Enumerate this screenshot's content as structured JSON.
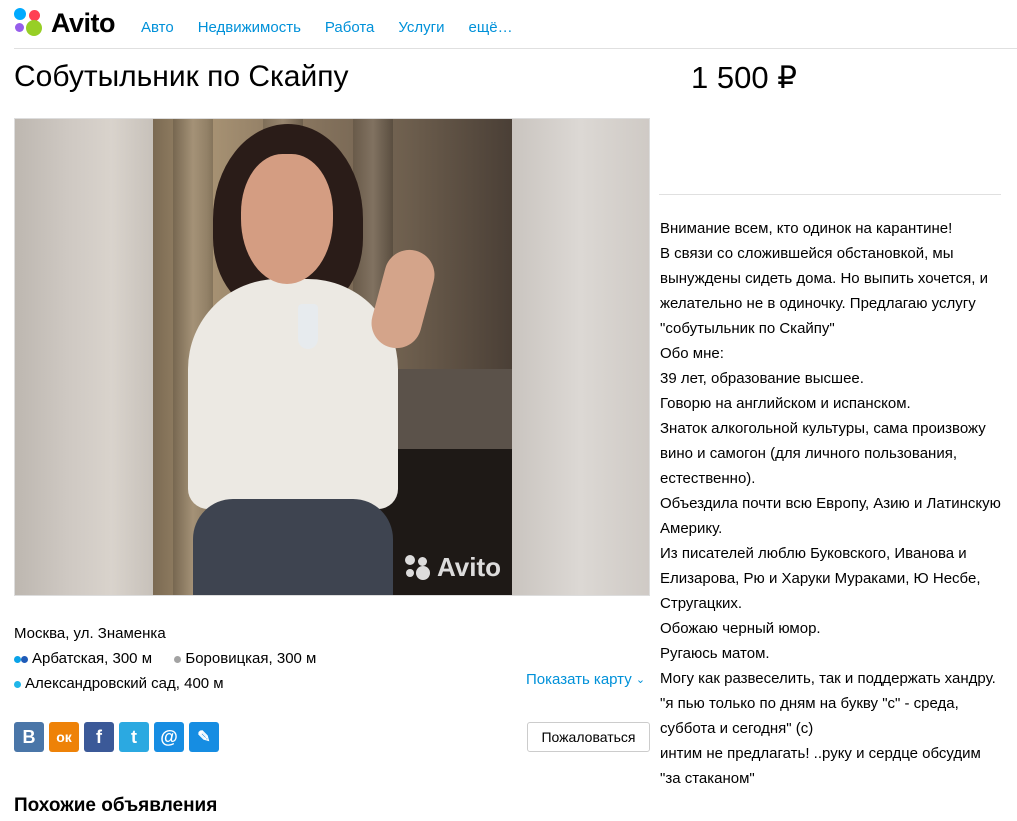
{
  "header": {
    "logo_text": "Avito",
    "nav": [
      "Авто",
      "Недвижимость",
      "Работа",
      "Услуги",
      "ещё…"
    ]
  },
  "listing": {
    "title": "Собутыльник по Скайпу",
    "price": "1 500 ₽",
    "watermark": "Avito"
  },
  "location": {
    "address": "Москва, ул. Знаменка",
    "metro": [
      {
        "name": "Арбатская, 300 м",
        "colors": [
          "#0aa3e8",
          "#1e5bb8"
        ]
      },
      {
        "name": "Боровицкая, 300 м",
        "colors": [
          "#a3a3a3"
        ]
      },
      {
        "name": "Александровский сад, 400 м",
        "colors": [
          "#1fb6e9"
        ]
      }
    ],
    "show_map": "Показать карту"
  },
  "social": [
    {
      "icon": "vk-icon",
      "glyph": "B",
      "color": "#4a76a8"
    },
    {
      "icon": "odnoklassniki-icon",
      "glyph": "ок",
      "color": "#ee8208"
    },
    {
      "icon": "facebook-icon",
      "glyph": "f",
      "color": "#3b5998"
    },
    {
      "icon": "twitter-icon",
      "glyph": "t",
      "color": "#2ba9e1"
    },
    {
      "icon": "mail-icon",
      "glyph": "@",
      "color": "#168de2"
    },
    {
      "icon": "livejournal-icon",
      "glyph": "✎",
      "color": "#168de2"
    }
  ],
  "complain_label": "Пожаловаться",
  "similar_title": "Похожие объявления",
  "description": [
    "Внимание всем, кто одинок на карантине!",
    "В связи со сложившейся обстановкой, мы вынуждены сидеть дома. Но выпить хочется, и желательно не в одиночку. Предлагаю услугу \"собутыльник по Скайпу\"",
    "Обо мне:",
    "39 лет, образование высшее.",
    "Говорю на английском и испанском.",
    "Знаток алкогольной культуры, сама произвожу вино и самогон (для личного пользования, естественно).",
    "Объездила почти всю Европу, Азию и Латинскую Америку.",
    "Из писателей люблю Буковского, Иванова и Елизарова, Рю и Харуки Мураками, Ю Несбе, Стругацких.",
    "Обожаю черный юмор.",
    "Ругаюсь матом.",
    "Могу как развеселить, так и поддержать хандру.",
    "\"я пью только по дням на букву \"с\" - среда, суббота и сегодня\" (с)",
    "интим не предлагать! ..руку и сердце обсудим \"за стаканом\""
  ]
}
